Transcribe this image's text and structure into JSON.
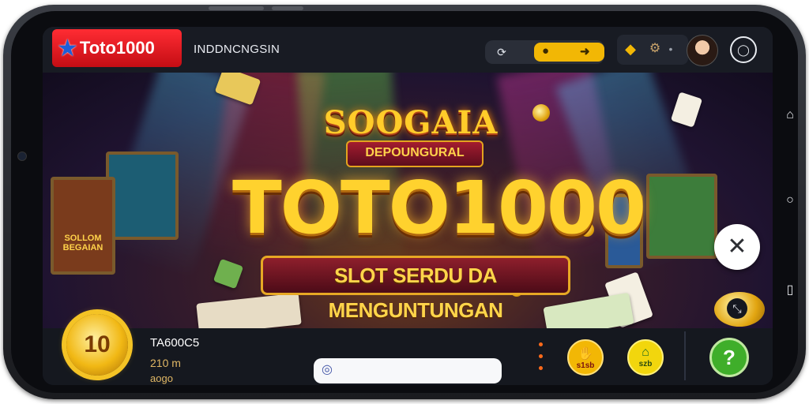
{
  "colors": {
    "brand_red": "#e2151c",
    "accent_gold": "#f2b705",
    "help_green": "#3fae2a"
  },
  "header": {
    "logo_text": "Toto1000",
    "logo_icon": "star-icon",
    "language_label": "INDDNCNGSIN",
    "toggle_icons": [
      "refresh-icon",
      "coin-icon",
      "arrow-icon"
    ],
    "right_icons": [
      "diamond-icon",
      "gear-icon",
      "dot-icon"
    ],
    "avatar": "user-avatar",
    "menu_icon": "menu-icon"
  },
  "banner": {
    "top_title": "SOOGAIA",
    "subtitle_badge": "DEPOUNGURAL",
    "main_title": "TOTO1000",
    "ribbon": "SLOT SERDU DA MENGUNTUNGAN",
    "left_card_text": "SOLLOM BEGAIAN",
    "close_icon": "close-icon",
    "expand_icon": "expand-icon"
  },
  "footer": {
    "badge_value": "10",
    "stat_label": "TA600C5",
    "stat_value": "210 m",
    "stat_sub": "aogo",
    "search_placeholder": "",
    "search_icon": "search-icon",
    "game_buttons": [
      {
        "label": "s1sb",
        "icon": "hand-icon"
      },
      {
        "label": "szb",
        "icon": "home-icon"
      }
    ],
    "help_label": "?"
  },
  "device": {
    "nav_icons": [
      "home-nav-icon",
      "circle-nav-icon",
      "back-nav-icon"
    ]
  }
}
